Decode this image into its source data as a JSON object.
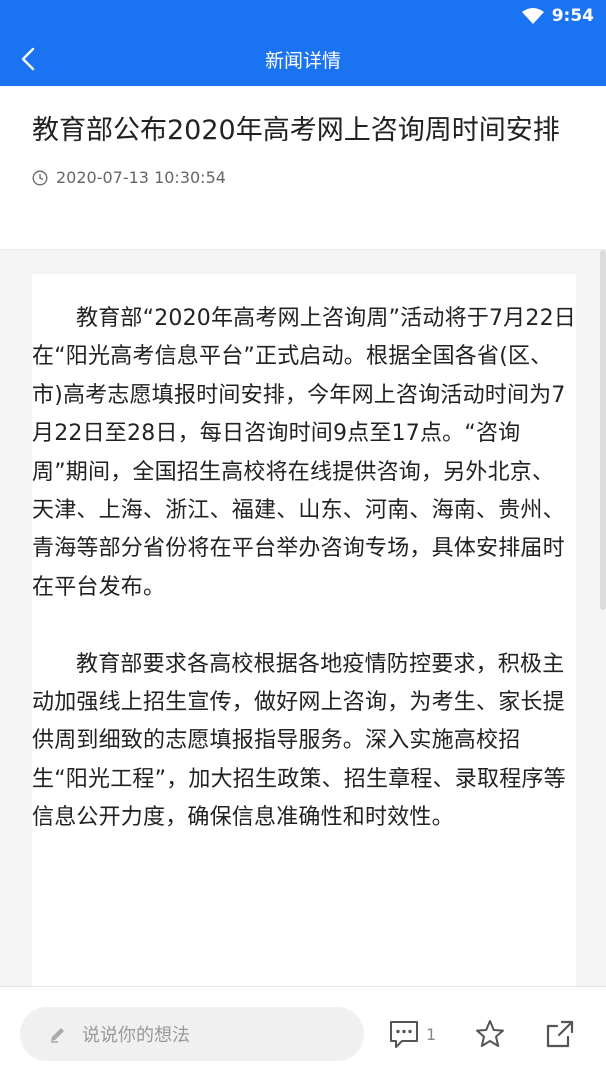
{
  "status": {
    "time": "9:54"
  },
  "nav": {
    "title": "新闻详情"
  },
  "article": {
    "title": "教育部公布2020年高考网上咨询周时间安排",
    "datetime": "2020-07-13 10:30:54",
    "paragraphs": [
      "教育部“2020年高考网上咨询周”活动将于7月22日在“阳光高考信息平台”正式启动。根据全国各省(区、市)高考志愿填报时间安排，今年网上咨询活动时间为7月22日至28日，每日咨询时间9点至17点。“咨询周”期间，全国招生高校将在线提供咨询，另外北京、天津、上海、浙江、福建、山东、河南、海南、贵州、青海等部分省份将在平台举办咨询专场，具体安排届时在平台发布。",
      "教育部要求各高校根据各地疫情防控要求，积极主动加强线上招生宣传，做好网上咨询，为考生、家长提供周到细致的志愿填报指导服务。深入实施高校招生“阳光工程”，加大招生政策、招生章程、录取程序等信息公开力度，确保信息准确性和时效性。"
    ]
  },
  "bottom": {
    "comment_placeholder": "说说你的想法",
    "comment_count": "1"
  },
  "colors": {
    "brand": "#1a73f0",
    "background": "#f5f5f5"
  },
  "icons": [
    "wifi-icon",
    "back-icon",
    "clock-icon",
    "pencil-icon",
    "comment-icon",
    "star-icon",
    "share-icon"
  ]
}
